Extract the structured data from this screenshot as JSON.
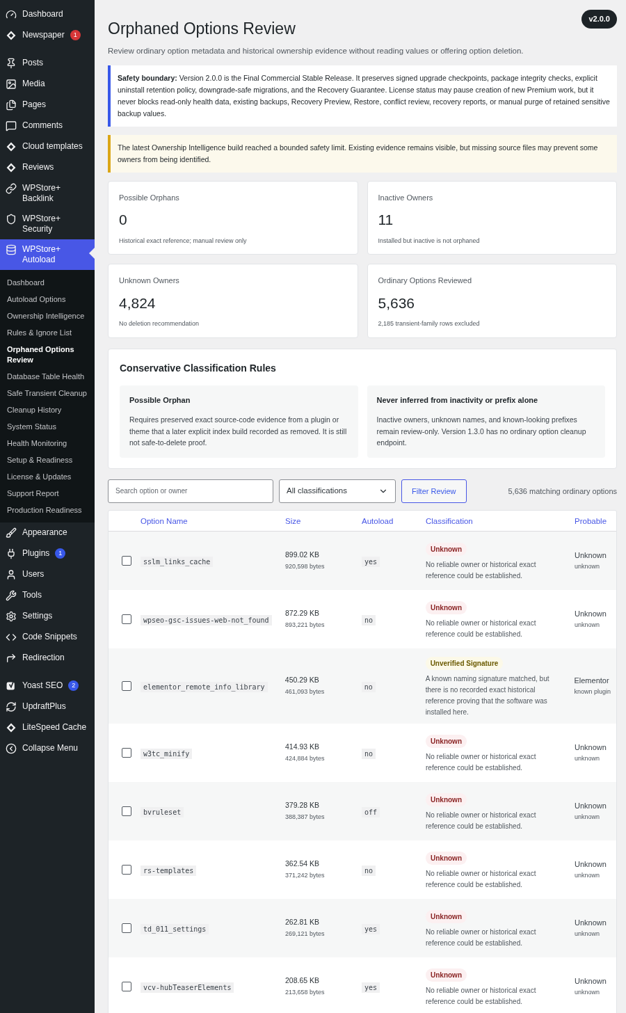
{
  "sidebar": {
    "items": [
      {
        "label": "Dashboard",
        "selected": false
      },
      {
        "label": "Newspaper",
        "selected": false,
        "badge": {
          "text": "1",
          "color": "#d63638"
        }
      },
      {
        "kind": "separator"
      },
      {
        "label": "Posts",
        "selected": false
      },
      {
        "label": "Media",
        "selected": false
      },
      {
        "label": "Pages",
        "selected": false
      },
      {
        "label": "Comments",
        "selected": false
      },
      {
        "label": "Cloud templates",
        "selected": false
      },
      {
        "label": "Reviews",
        "selected": false
      },
      {
        "label": "WPStore+ Backlink",
        "selected": false
      },
      {
        "label": "WPStore+ Security",
        "selected": false
      },
      {
        "label": "WPStore+ Autoload",
        "selected": true,
        "children": [
          {
            "label": "Dashboard",
            "selected": false
          },
          {
            "label": "Autoload Options",
            "selected": false
          },
          {
            "label": "Ownership Intelligence",
            "selected": false
          },
          {
            "label": "Rules & Ignore List",
            "selected": false
          },
          {
            "label": "Orphaned Options Review",
            "selected": true
          },
          {
            "label": "Database Table Health",
            "selected": false
          },
          {
            "label": "Safe Transient Cleanup",
            "selected": false
          },
          {
            "label": "Cleanup History",
            "selected": false
          },
          {
            "label": "System Status",
            "selected": false
          },
          {
            "label": "Health Monitoring",
            "selected": false
          },
          {
            "label": "Setup & Readiness",
            "selected": false
          },
          {
            "label": "License & Updates",
            "selected": false
          },
          {
            "label": "Support Report",
            "selected": false
          },
          {
            "label": "Production Readiness",
            "selected": false
          }
        ]
      },
      {
        "label": "Appearance",
        "selected": false
      },
      {
        "label": "Plugins",
        "selected": false,
        "badge": {
          "text": "1",
          "color": "#3858e9"
        }
      },
      {
        "label": "Users",
        "selected": false
      },
      {
        "label": "Tools",
        "selected": false
      },
      {
        "label": "Settings",
        "selected": false
      },
      {
        "label": "Code Snippets",
        "selected": false
      },
      {
        "label": "Redirection",
        "selected": false
      },
      {
        "kind": "separator"
      },
      {
        "label": "Yoast SEO",
        "selected": false,
        "badge": {
          "text": "2",
          "color": "#3858e9"
        }
      },
      {
        "label": "UpdraftPlus",
        "selected": false
      },
      {
        "label": "LiteSpeed Cache",
        "selected": false
      },
      {
        "label": "Collapse Menu",
        "selected": false
      }
    ]
  },
  "version": "v2.0.0",
  "title": "Orphaned Options Review",
  "subtitle": "Review ordinary option metadata and historical ownership evidence without reading values or offering option deletion.",
  "notices": [
    {
      "kind": "info",
      "text": "**Safety boundary:** Version 2.0.0 is the Final Commercial Stable Release. It preserves signed upgrade checkpoints, package integrity checks, explicit uninstall retention policy, downgrade-safe migrations, and the Recovery Guarantee. License status may pause creation of new Premium work, but it never blocks read-only health data, existing backups, Recovery Preview, Restore, conflict review, recovery reports, or manual purge of retained sensitive backup values."
    },
    {
      "kind": "warning",
      "text": "The latest Ownership Intelligence build reached a bounded safety limit. Existing evidence remains visible, but missing source files may prevent some owners from being identified."
    }
  ],
  "stats": [
    {
      "label": "Possible Orphans",
      "value": "0",
      "note": "Historical exact reference; manual review only"
    },
    {
      "label": "Inactive Owners",
      "value": "11",
      "note": "Installed but inactive is not orphaned"
    },
    {
      "label": "Unknown Owners",
      "value": "4,824",
      "note": "No deletion recommendation"
    },
    {
      "label": "Ordinary Options Reviewed",
      "value": "5,636",
      "note": "2,185 transient-family rows excluded"
    }
  ],
  "rules": {
    "title": "Conservative Classification Rules",
    "items": [
      {
        "title": "Possible Orphan",
        "text": "Requires preserved exact source-code evidence from a plugin or theme that a later explicit index build recorded as removed. It is still not safe-to-delete proof."
      },
      {
        "title": "Never inferred from inactivity or prefix alone",
        "text": "Inactive owners, unknown names, and known-looking prefixes remain review-only. Version 1.3.0 has no ordinary option cleanup endpoint."
      }
    ]
  },
  "filters": {
    "search_placeholder": "Search option or owner",
    "select_value": "All classifications",
    "button": "Filter Review",
    "count": "5,636 matching ordinary options"
  },
  "table": {
    "columns": [
      "Option Name",
      "Size",
      "Autoload",
      "Classification",
      "Probable"
    ],
    "rows": [
      {
        "checked": false,
        "name": "sslm_links_cache",
        "size": "899.02 KB",
        "bytes": "920,598 bytes",
        "autoload": "yes",
        "classification": {
          "kind": "unknown",
          "label": "Unknown"
        },
        "description": "No reliable owner or historical exact reference could be established.",
        "owner": "Unknown",
        "owner_type": "unknown"
      },
      {
        "checked": false,
        "name": "wpseo-gsc-issues-web-not_found",
        "size": "872.29 KB",
        "bytes": "893,221 bytes",
        "autoload": "no",
        "classification": {
          "kind": "unknown",
          "label": "Unknown"
        },
        "description": "No reliable owner or historical exact reference could be established.",
        "owner": "Unknown",
        "owner_type": "unknown"
      },
      {
        "checked": false,
        "name": "elementor_remote_info_library",
        "size": "450.29 KB",
        "bytes": "461,093 bytes",
        "autoload": "no",
        "classification": {
          "kind": "unverified",
          "label": "Unverified Signature"
        },
        "description": "A known naming signature matched, but there is no recorded exact historical reference proving that the software was installed here.",
        "owner": "Elementor",
        "owner_type": "known plugin"
      },
      {
        "checked": false,
        "name": "w3tc_minify",
        "size": "414.93 KB",
        "bytes": "424,884 bytes",
        "autoload": "no",
        "classification": {
          "kind": "unknown",
          "label": "Unknown"
        },
        "description": "No reliable owner or historical exact reference could be established.",
        "owner": "Unknown",
        "owner_type": "unknown"
      },
      {
        "checked": false,
        "name": "bvruleset",
        "size": "379.28 KB",
        "bytes": "388,387 bytes",
        "autoload": "off",
        "classification": {
          "kind": "unknown",
          "label": "Unknown"
        },
        "description": "No reliable owner or historical exact reference could be established.",
        "owner": "Unknown",
        "owner_type": "unknown"
      },
      {
        "checked": false,
        "name": "rs-templates",
        "size": "362.54 KB",
        "bytes": "371,242 bytes",
        "autoload": "no",
        "classification": {
          "kind": "unknown",
          "label": "Unknown"
        },
        "description": "No reliable owner or historical exact reference could be established.",
        "owner": "Unknown",
        "owner_type": "unknown"
      },
      {
        "checked": false,
        "name": "td_011_settings",
        "size": "262.81 KB",
        "bytes": "269,121 bytes",
        "autoload": "yes",
        "classification": {
          "kind": "unknown",
          "label": "Unknown"
        },
        "description": "No reliable owner or historical exact reference could be established.",
        "owner": "Unknown",
        "owner_type": "unknown"
      },
      {
        "checked": false,
        "name": "vcv-hubTeaserElements",
        "size": "208.65 KB",
        "bytes": "213,658 bytes",
        "autoload": "yes",
        "classification": {
          "kind": "unknown",
          "label": "Unknown"
        },
        "description": "No reliable owner or historical exact reference could be established.",
        "owner": "Unknown",
        "owner_type": "unknown"
      }
    ]
  }
}
